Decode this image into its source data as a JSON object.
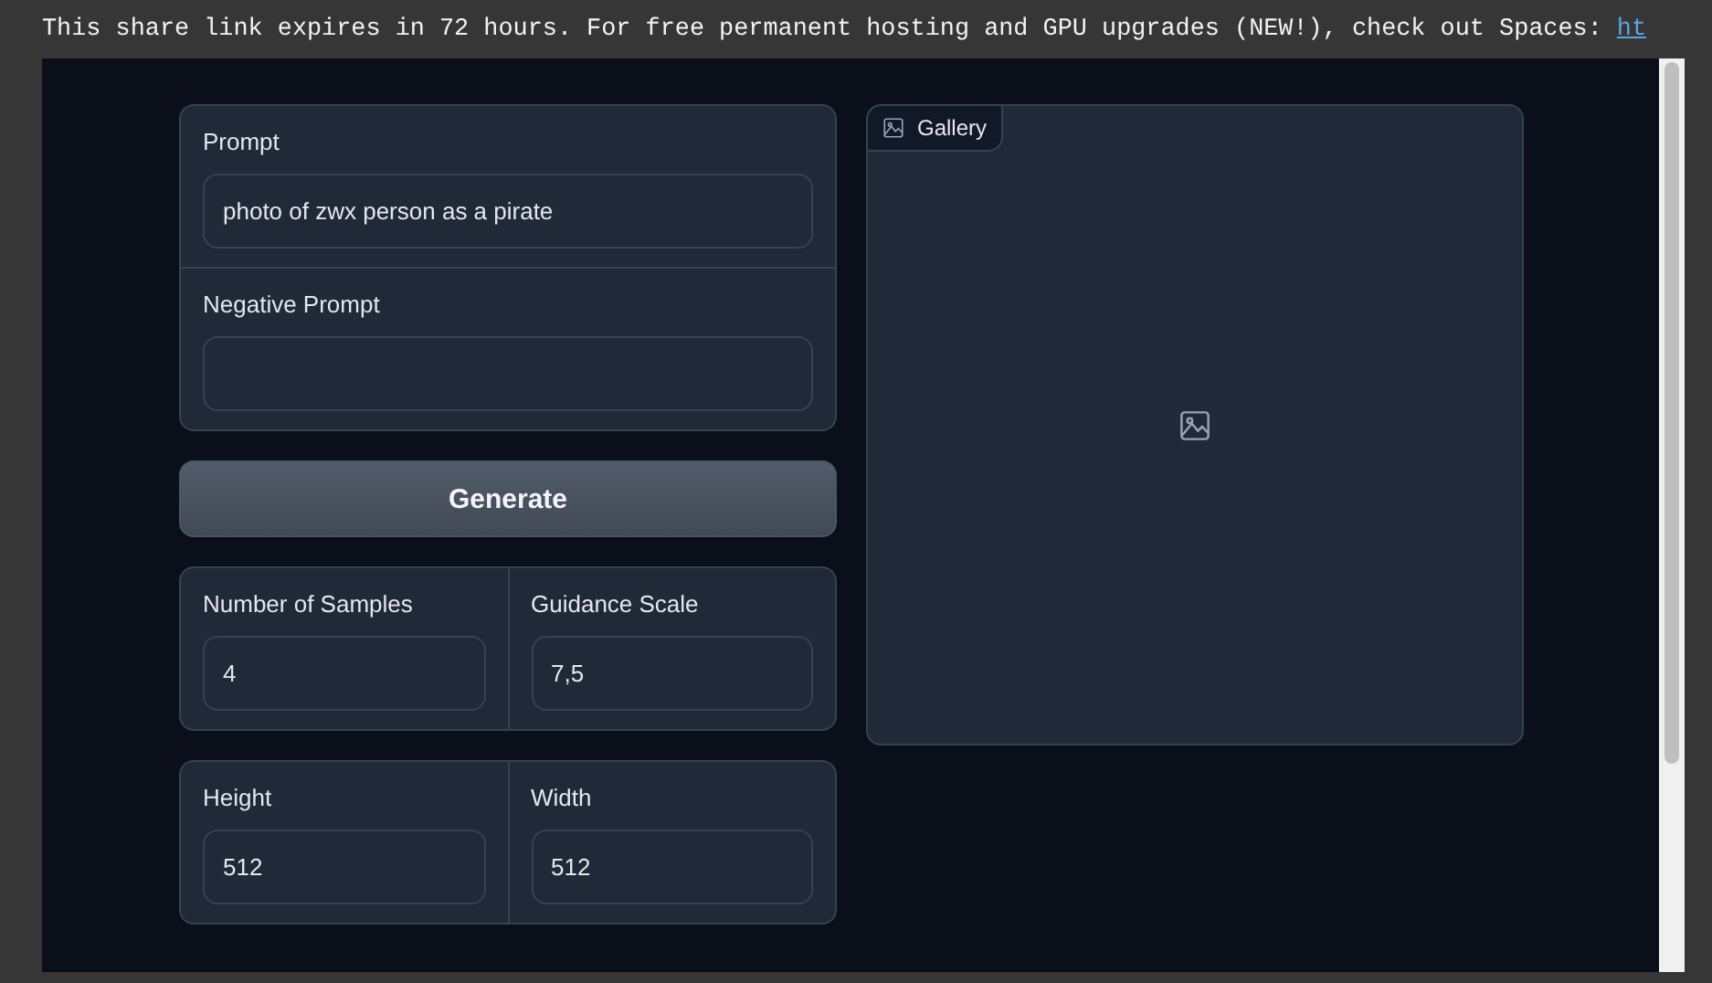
{
  "banner": {
    "text": "This share link expires in 72 hours. For free permanent hosting and GPU upgrades (NEW!), check out Spaces:",
    "link": "ht"
  },
  "prompt_fields": [
    {
      "label": "Prompt",
      "value": "photo of zwx person as a pirate"
    },
    {
      "label": "Negative Prompt"
    }
  ],
  "generate_button": "Generate",
  "number_rows": [
    [
      {
        "label": "Number of Samples",
        "value": "4"
      },
      {
        "label": "Guidance Scale",
        "value": "7,5"
      }
    ],
    [
      {
        "label": "Height",
        "value": "512"
      },
      {
        "label": "Width",
        "value": "512"
      }
    ]
  ],
  "gallery": {
    "label": "Gallery"
  }
}
